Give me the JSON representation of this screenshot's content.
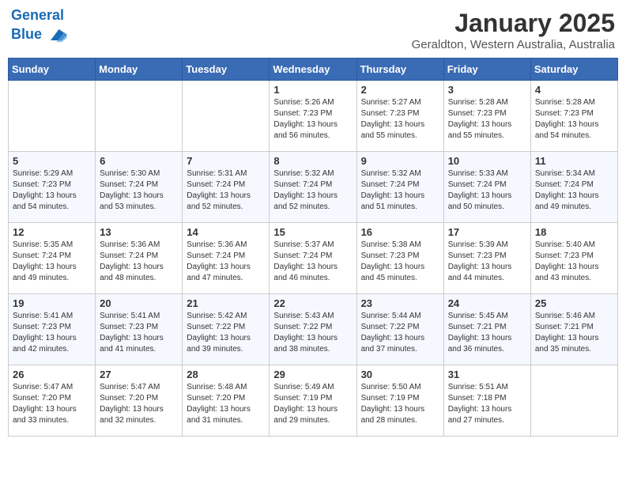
{
  "header": {
    "logo_line1": "General",
    "logo_line2": "Blue",
    "month": "January 2025",
    "location": "Geraldton, Western Australia, Australia"
  },
  "weekdays": [
    "Sunday",
    "Monday",
    "Tuesday",
    "Wednesday",
    "Thursday",
    "Friday",
    "Saturday"
  ],
  "weeks": [
    [
      {
        "day": "",
        "info": ""
      },
      {
        "day": "",
        "info": ""
      },
      {
        "day": "",
        "info": ""
      },
      {
        "day": "1",
        "info": "Sunrise: 5:26 AM\nSunset: 7:23 PM\nDaylight: 13 hours\nand 56 minutes."
      },
      {
        "day": "2",
        "info": "Sunrise: 5:27 AM\nSunset: 7:23 PM\nDaylight: 13 hours\nand 55 minutes."
      },
      {
        "day": "3",
        "info": "Sunrise: 5:28 AM\nSunset: 7:23 PM\nDaylight: 13 hours\nand 55 minutes."
      },
      {
        "day": "4",
        "info": "Sunrise: 5:28 AM\nSunset: 7:23 PM\nDaylight: 13 hours\nand 54 minutes."
      }
    ],
    [
      {
        "day": "5",
        "info": "Sunrise: 5:29 AM\nSunset: 7:23 PM\nDaylight: 13 hours\nand 54 minutes."
      },
      {
        "day": "6",
        "info": "Sunrise: 5:30 AM\nSunset: 7:24 PM\nDaylight: 13 hours\nand 53 minutes."
      },
      {
        "day": "7",
        "info": "Sunrise: 5:31 AM\nSunset: 7:24 PM\nDaylight: 13 hours\nand 52 minutes."
      },
      {
        "day": "8",
        "info": "Sunrise: 5:32 AM\nSunset: 7:24 PM\nDaylight: 13 hours\nand 52 minutes."
      },
      {
        "day": "9",
        "info": "Sunrise: 5:32 AM\nSunset: 7:24 PM\nDaylight: 13 hours\nand 51 minutes."
      },
      {
        "day": "10",
        "info": "Sunrise: 5:33 AM\nSunset: 7:24 PM\nDaylight: 13 hours\nand 50 minutes."
      },
      {
        "day": "11",
        "info": "Sunrise: 5:34 AM\nSunset: 7:24 PM\nDaylight: 13 hours\nand 49 minutes."
      }
    ],
    [
      {
        "day": "12",
        "info": "Sunrise: 5:35 AM\nSunset: 7:24 PM\nDaylight: 13 hours\nand 49 minutes."
      },
      {
        "day": "13",
        "info": "Sunrise: 5:36 AM\nSunset: 7:24 PM\nDaylight: 13 hours\nand 48 minutes."
      },
      {
        "day": "14",
        "info": "Sunrise: 5:36 AM\nSunset: 7:24 PM\nDaylight: 13 hours\nand 47 minutes."
      },
      {
        "day": "15",
        "info": "Sunrise: 5:37 AM\nSunset: 7:24 PM\nDaylight: 13 hours\nand 46 minutes."
      },
      {
        "day": "16",
        "info": "Sunrise: 5:38 AM\nSunset: 7:23 PM\nDaylight: 13 hours\nand 45 minutes."
      },
      {
        "day": "17",
        "info": "Sunrise: 5:39 AM\nSunset: 7:23 PM\nDaylight: 13 hours\nand 44 minutes."
      },
      {
        "day": "18",
        "info": "Sunrise: 5:40 AM\nSunset: 7:23 PM\nDaylight: 13 hours\nand 43 minutes."
      }
    ],
    [
      {
        "day": "19",
        "info": "Sunrise: 5:41 AM\nSunset: 7:23 PM\nDaylight: 13 hours\nand 42 minutes."
      },
      {
        "day": "20",
        "info": "Sunrise: 5:41 AM\nSunset: 7:23 PM\nDaylight: 13 hours\nand 41 minutes."
      },
      {
        "day": "21",
        "info": "Sunrise: 5:42 AM\nSunset: 7:22 PM\nDaylight: 13 hours\nand 39 minutes."
      },
      {
        "day": "22",
        "info": "Sunrise: 5:43 AM\nSunset: 7:22 PM\nDaylight: 13 hours\nand 38 minutes."
      },
      {
        "day": "23",
        "info": "Sunrise: 5:44 AM\nSunset: 7:22 PM\nDaylight: 13 hours\nand 37 minutes."
      },
      {
        "day": "24",
        "info": "Sunrise: 5:45 AM\nSunset: 7:21 PM\nDaylight: 13 hours\nand 36 minutes."
      },
      {
        "day": "25",
        "info": "Sunrise: 5:46 AM\nSunset: 7:21 PM\nDaylight: 13 hours\nand 35 minutes."
      }
    ],
    [
      {
        "day": "26",
        "info": "Sunrise: 5:47 AM\nSunset: 7:20 PM\nDaylight: 13 hours\nand 33 minutes."
      },
      {
        "day": "27",
        "info": "Sunrise: 5:47 AM\nSunset: 7:20 PM\nDaylight: 13 hours\nand 32 minutes."
      },
      {
        "day": "28",
        "info": "Sunrise: 5:48 AM\nSunset: 7:20 PM\nDaylight: 13 hours\nand 31 minutes."
      },
      {
        "day": "29",
        "info": "Sunrise: 5:49 AM\nSunset: 7:19 PM\nDaylight: 13 hours\nand 29 minutes."
      },
      {
        "day": "30",
        "info": "Sunrise: 5:50 AM\nSunset: 7:19 PM\nDaylight: 13 hours\nand 28 minutes."
      },
      {
        "day": "31",
        "info": "Sunrise: 5:51 AM\nSunset: 7:18 PM\nDaylight: 13 hours\nand 27 minutes."
      },
      {
        "day": "",
        "info": ""
      }
    ]
  ]
}
